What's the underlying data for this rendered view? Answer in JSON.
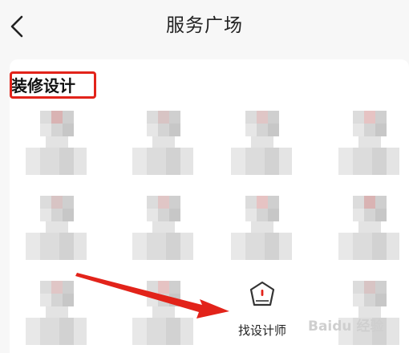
{
  "header": {
    "title": "服务广场",
    "back_icon": "back-chevron-icon"
  },
  "section": {
    "title": "装修设计"
  },
  "designers": {
    "count_visible": 12
  },
  "find_designer": {
    "label": "找设计师",
    "icon": "designer-badge-icon"
  },
  "watermark": {
    "text": "Baidu 经验"
  },
  "colors": {
    "annotation_red": "#e2231a",
    "background": "#f7f7f7",
    "card": "#ffffff"
  }
}
